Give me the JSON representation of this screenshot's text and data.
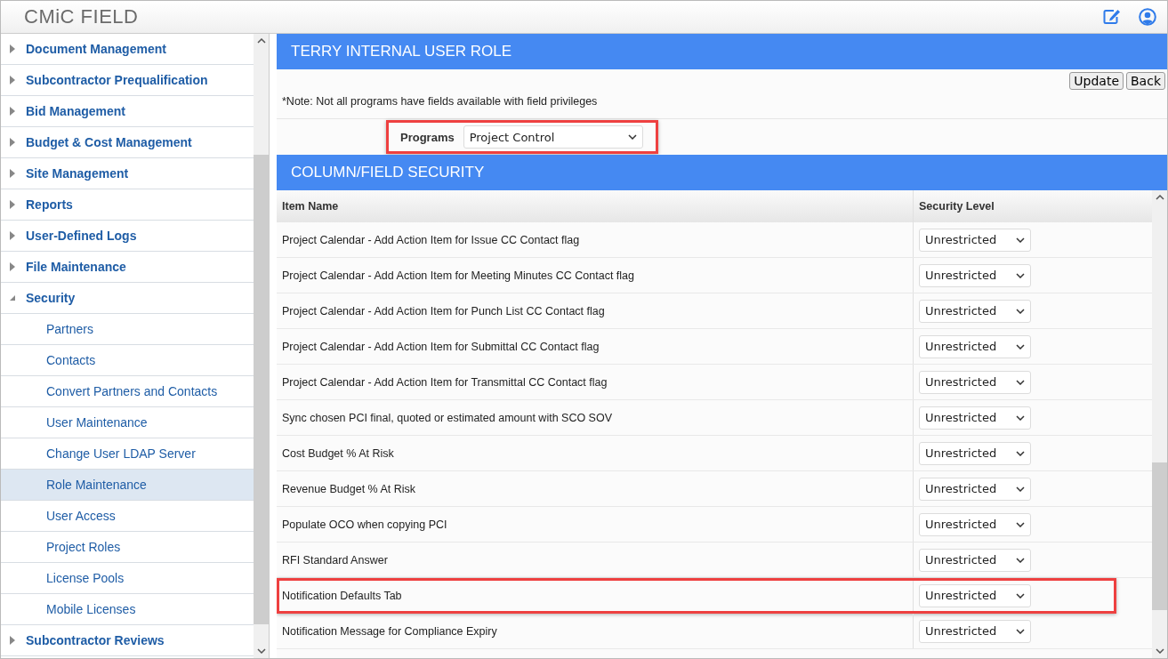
{
  "app": {
    "logo": "CMiC FIELD"
  },
  "sidebar": {
    "items": [
      {
        "label": "Document Management",
        "expanded": false
      },
      {
        "label": "Subcontractor Prequalification",
        "expanded": false
      },
      {
        "label": "Bid Management",
        "expanded": false
      },
      {
        "label": "Budget & Cost Management",
        "expanded": false
      },
      {
        "label": "Site Management",
        "expanded": false
      },
      {
        "label": "Reports",
        "expanded": false
      },
      {
        "label": "User-Defined Logs",
        "expanded": false
      },
      {
        "label": "File Maintenance",
        "expanded": false
      },
      {
        "label": "Security",
        "expanded": true,
        "children": [
          {
            "label": "Partners",
            "selected": false
          },
          {
            "label": "Contacts",
            "selected": false
          },
          {
            "label": "Convert Partners and Contacts",
            "selected": false
          },
          {
            "label": "User Maintenance",
            "selected": false
          },
          {
            "label": "Change User LDAP Server",
            "selected": false
          },
          {
            "label": "Role Maintenance",
            "selected": true
          },
          {
            "label": "User Access",
            "selected": false
          },
          {
            "label": "Project Roles",
            "selected": false
          },
          {
            "label": "License Pools",
            "selected": false
          },
          {
            "label": "Mobile Licenses",
            "selected": false
          }
        ]
      },
      {
        "label": "Subcontractor Reviews",
        "expanded": false
      }
    ]
  },
  "role_panel": {
    "title": "TERRY INTERNAL USER ROLE",
    "buttons": [
      "Update",
      "Back"
    ],
    "note": "*Note: Not all programs have fields available with field privileges",
    "programs": {
      "label": "Programs",
      "value": "Project Control",
      "highlighted": true
    }
  },
  "security_panel": {
    "title": "COLUMN/FIELD SECURITY",
    "columns": [
      "Item Name",
      "Security Level"
    ],
    "rows": [
      {
        "item": "Project Calendar - Add Action Item for Issue CC Contact flag",
        "level": "Unrestricted",
        "highlighted": false
      },
      {
        "item": "Project Calendar - Add Action Item for Meeting Minutes CC Contact flag",
        "level": "Unrestricted",
        "highlighted": false
      },
      {
        "item": "Project Calendar - Add Action Item for Punch List CC Contact flag",
        "level": "Unrestricted",
        "highlighted": false
      },
      {
        "item": "Project Calendar - Add Action Item for Submittal CC Contact flag",
        "level": "Unrestricted",
        "highlighted": false
      },
      {
        "item": "Project Calendar - Add Action Item for Transmittal CC Contact flag",
        "level": "Unrestricted",
        "highlighted": false
      },
      {
        "item": "Sync chosen PCI final, quoted or estimated amount with SCO SOV",
        "level": "Unrestricted",
        "highlighted": false
      },
      {
        "item": "Cost Budget % At Risk",
        "level": "Unrestricted",
        "highlighted": false
      },
      {
        "item": "Revenue Budget % At Risk",
        "level": "Unrestricted",
        "highlighted": false
      },
      {
        "item": "Populate OCO when copying PCI",
        "level": "Unrestricted",
        "highlighted": false
      },
      {
        "item": "RFI Standard Answer",
        "level": "Unrestricted",
        "highlighted": false
      },
      {
        "item": "Notification Defaults Tab",
        "level": "Unrestricted",
        "highlighted": true
      },
      {
        "item": "Notification Message for Compliance Expiry",
        "level": "Unrestricted",
        "highlighted": false
      }
    ]
  }
}
